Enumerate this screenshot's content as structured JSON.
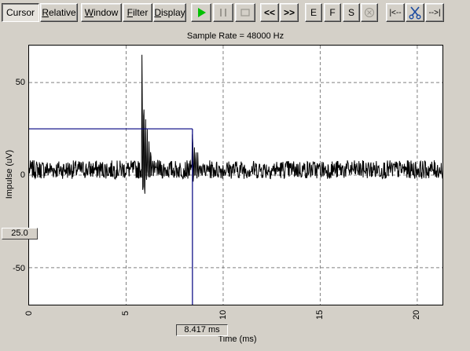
{
  "toolbar": {
    "cursor": "Cursor",
    "relative_u": "R",
    "relative_rest": "elative",
    "window_u": "W",
    "window_rest": "indow",
    "filter_u": "F",
    "filter_rest": "ilter",
    "display_u": "D",
    "display_rest": "isplay",
    "prev": "<<",
    "next": ">>",
    "e": "E",
    "f": "F",
    "s": "S",
    "go_start": "|<--",
    "go_end": "-->|"
  },
  "colors": {
    "cursor_line": "#000080",
    "play": "#00c000",
    "signal": "#000000",
    "grid": "#808080"
  },
  "chart_data": {
    "type": "line",
    "title": "Sample Rate = 48000 Hz",
    "xlabel": "Time (ms)",
    "ylabel": "Impulse (uV)",
    "xlim": [
      0,
      21.3
    ],
    "ylim": [
      -70,
      70
    ],
    "xticks": [
      "0",
      "5",
      "10",
      "15",
      "20"
    ],
    "yticks": [
      "50",
      "0",
      "-50"
    ],
    "grid": true,
    "cursor": {
      "x": 8.417,
      "y": 25.0
    },
    "cursor_y_label": "25.0",
    "cursor_x_readout": "8.417 ms",
    "events": [
      {
        "x": 5.8,
        "peak": 65,
        "trough": -22
      },
      {
        "x": 8.4,
        "peak": 22,
        "trough": -10
      }
    ]
  }
}
